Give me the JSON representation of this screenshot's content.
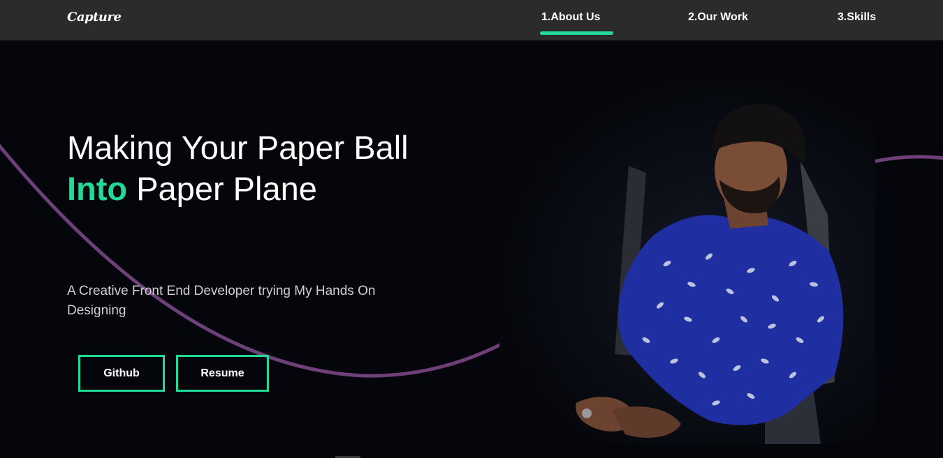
{
  "nav": {
    "logo": "Capture",
    "links": [
      {
        "label": "1.About Us",
        "active": true
      },
      {
        "label": "2.Our Work",
        "active": false
      },
      {
        "label": "3.Skills",
        "active": false
      }
    ]
  },
  "hero": {
    "headline_part1": "Making Your Paper Ball ",
    "headline_highlight": "Into",
    "headline_part2": " Paper Plane",
    "subtitle": "A Creative Front End Developer trying My Hands On Designing",
    "buttons": {
      "github": "Github",
      "resume": "Resume"
    },
    "photo": "portrait-photo"
  },
  "colors": {
    "accent": "#23d997",
    "curve": "#6e3f78",
    "nav_bg": "#2b2b2b",
    "page_bg": "#04060b",
    "shirt": "#1f2ea0"
  }
}
